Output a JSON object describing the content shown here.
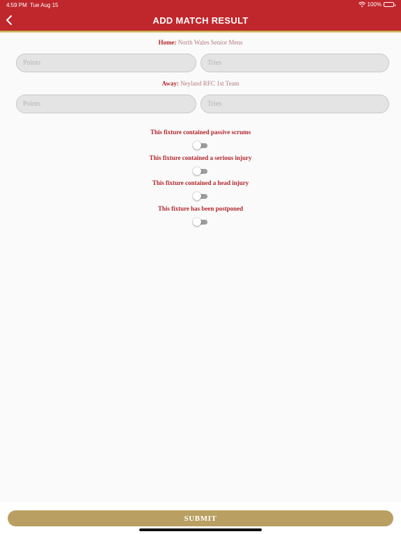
{
  "status_bar": {
    "time": "4:59 PM",
    "date": "Tue Aug 15",
    "battery": "100%"
  },
  "header": {
    "title": "ADD MATCH RESULT",
    "back_icon": "chevron-left-icon"
  },
  "home": {
    "key": "Home:",
    "name": "North Wales Senior Mens",
    "points_placeholder": "Points",
    "tries_placeholder": "Tries"
  },
  "away": {
    "key": "Away:",
    "name": "Neyland RFC 1st Team",
    "points_placeholder": "Points",
    "tries_placeholder": "Tries"
  },
  "toggles": [
    {
      "label": "This fixture contained passive scrums",
      "on": false
    },
    {
      "label": "This fixture contained a serious injury",
      "on": false
    },
    {
      "label": "This fixture contained a head injury",
      "on": false
    },
    {
      "label": "This fixture has been postponed",
      "on": false
    }
  ],
  "footer": {
    "submit_label": "SUBMIT"
  },
  "colors": {
    "header_red": "#c0272d",
    "label_red": "#b1252b",
    "submit_gold": "#b9a062"
  }
}
